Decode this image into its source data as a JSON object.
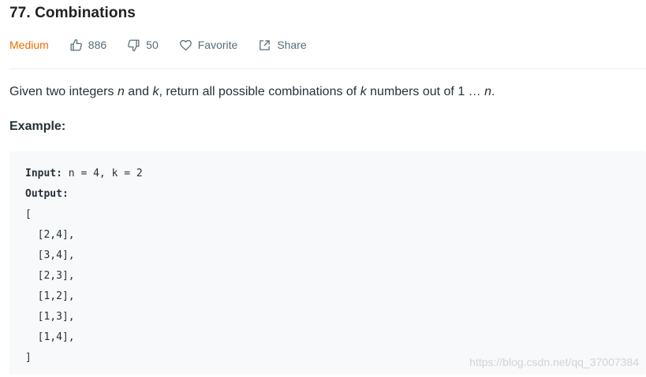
{
  "problem": {
    "title": "77. Combinations",
    "difficulty": "Medium",
    "likes": "886",
    "dislikes": "50",
    "favorite_label": "Favorite",
    "share_label": "Share",
    "description": {
      "part1": "Given two integers ",
      "n": "n",
      "part2": " and ",
      "k": "k",
      "part3": ", return all possible combinations of ",
      "k2": "k",
      "part4": " numbers out of 1 … ",
      "n2": "n",
      "part5": "."
    },
    "example_heading": "Example:",
    "example": {
      "input_label": "Input:",
      "input_value": " n = 4, k = 2",
      "output_label": "Output:",
      "lines": [
        "[",
        "  [2,4],",
        "  [3,4],",
        "  [2,3],",
        "  [1,2],",
        "  [1,3],",
        "  [1,4],",
        "]"
      ]
    }
  },
  "watermark": "https://blog.csdn.net/qq_37007384",
  "colors": {
    "difficulty_medium": "#ef6c00",
    "meta_text": "#546e7a",
    "code_background": "#f7f9fa"
  },
  "icons": [
    "thumbs-up-icon",
    "thumbs-down-icon",
    "heart-icon",
    "share-icon"
  ]
}
